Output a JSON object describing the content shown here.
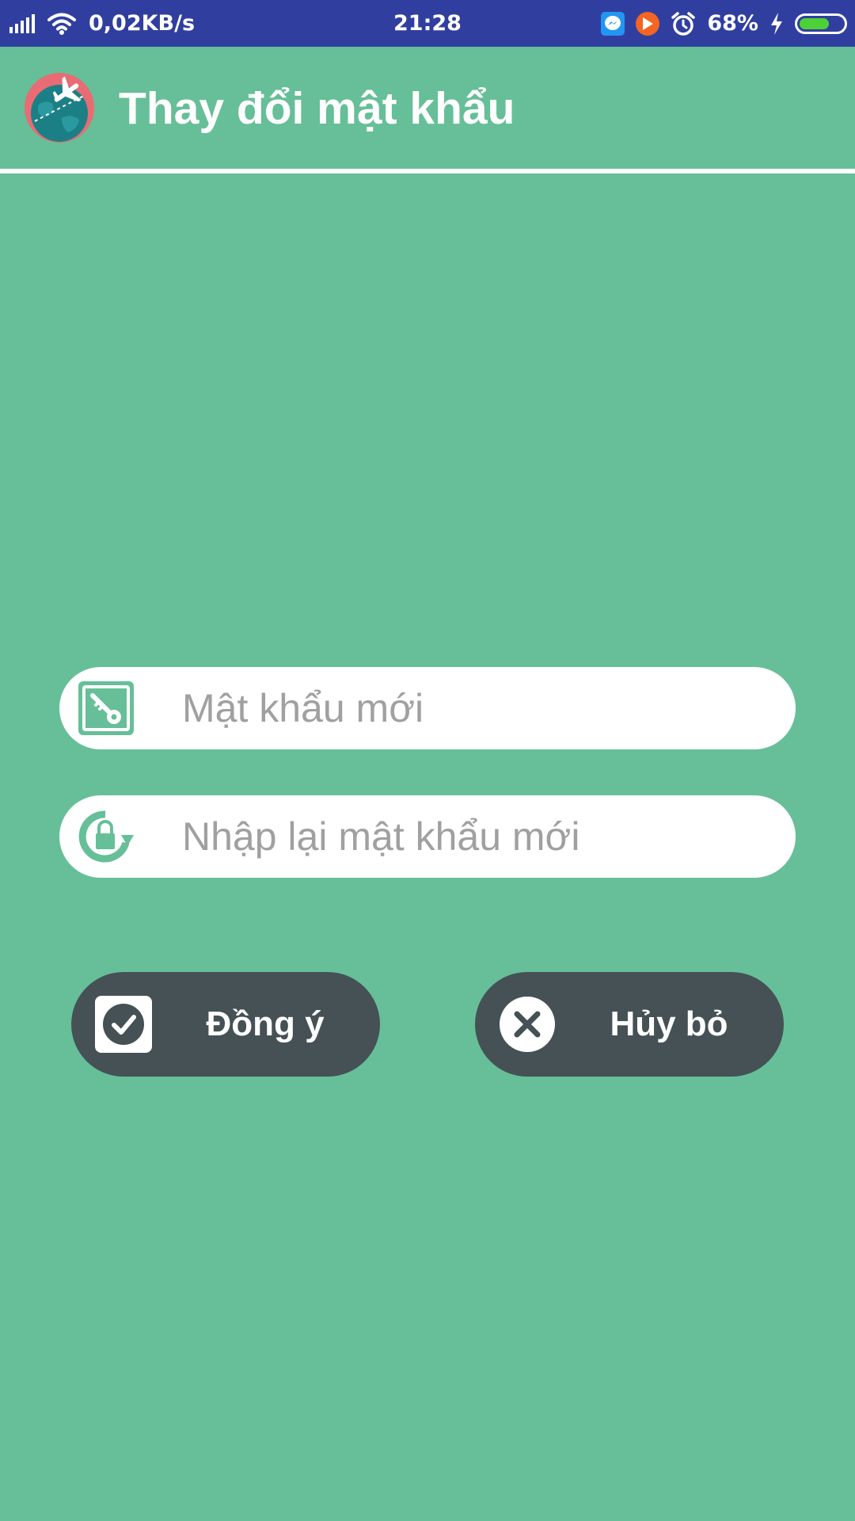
{
  "status_bar": {
    "network_speed": "0,02KB/s",
    "time": "21:28",
    "battery_percent": "68%",
    "battery_level": 0.68,
    "icons": [
      "signal-icon",
      "wifi-icon",
      "messenger-icon",
      "video-play-icon",
      "alarm-icon",
      "charging-icon",
      "battery-icon"
    ]
  },
  "app_bar": {
    "title": "Thay đổi mật khẩu",
    "logo_icon": "globe-airplane-logo"
  },
  "form": {
    "new_password_placeholder": "Mật khẩu mới",
    "new_password_value": "",
    "new_password_icon": "key-icon",
    "confirm_password_placeholder": "Nhập lại mật khẩu mới",
    "confirm_password_value": "",
    "confirm_password_icon": "lock-refresh-icon"
  },
  "buttons": {
    "confirm_label": "Đồng ý",
    "confirm_icon": "check-icon",
    "cancel_label": "Hủy bỏ",
    "cancel_icon": "close-circle-icon"
  },
  "colors": {
    "background": "#66bf98",
    "status_bar": "#303f9f",
    "button": "#455155",
    "field": "#ffffff",
    "accent_icon": "#66bf98"
  }
}
